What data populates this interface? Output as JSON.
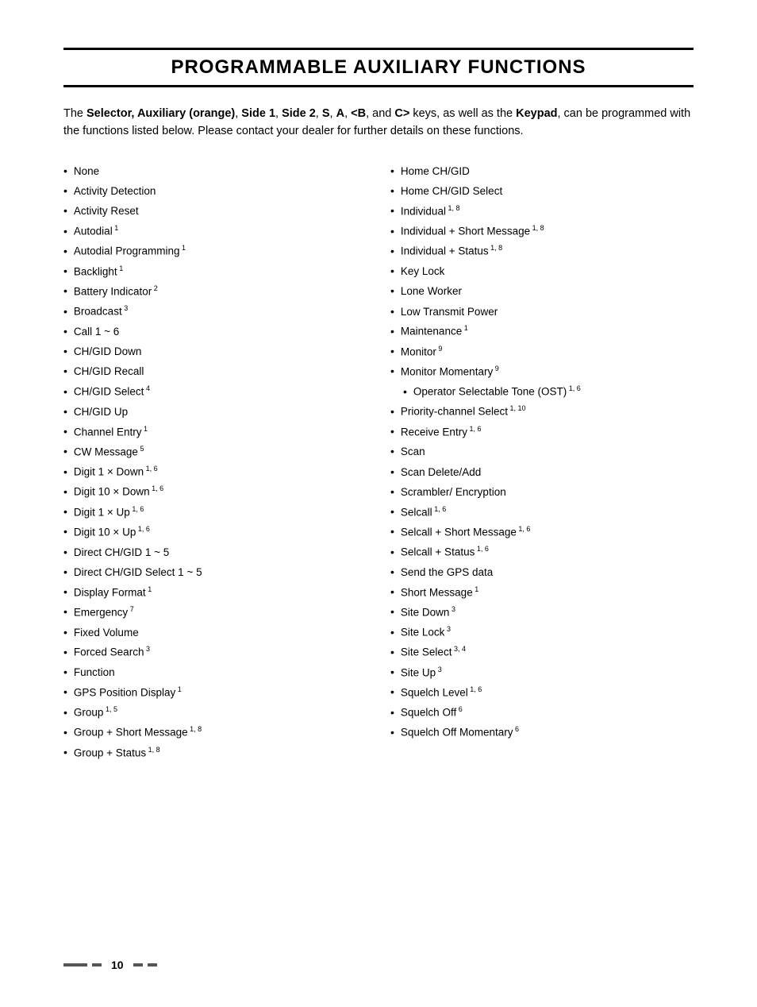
{
  "page": {
    "title": "PROGRAMMABLE AUXILIARY FUNCTIONS",
    "intro": {
      "part1": "The ",
      "bold1": "Selector, Auxiliary (orange)",
      "part2": ", ",
      "bold2": "Side 1",
      "part3": ", ",
      "bold3": "Side 2",
      "part4": ", ",
      "bold4": "S",
      "part5": ", ",
      "bold5": "A",
      "part6": ", ",
      "bold6": "<B",
      "part7": ", and ",
      "bold7": "C>",
      "part8": " keys, as well as the ",
      "bold8": "Keypad",
      "part9": ", can be programmed with the functions listed below. Please contact your dealer for further details on these functions."
    },
    "left_column": [
      {
        "text": "None",
        "sup": ""
      },
      {
        "text": "Activity Detection",
        "sup": ""
      },
      {
        "text": "Activity Reset",
        "sup": ""
      },
      {
        "text": "Autodial",
        "sup": "1"
      },
      {
        "text": "Autodial Programming",
        "sup": "1"
      },
      {
        "text": "Backlight",
        "sup": "1"
      },
      {
        "text": "Battery Indicator",
        "sup": "2"
      },
      {
        "text": "Broadcast",
        "sup": "3"
      },
      {
        "text": "Call 1 ~ 6",
        "sup": ""
      },
      {
        "text": "CH/GID Down",
        "sup": ""
      },
      {
        "text": "CH/GID Recall",
        "sup": ""
      },
      {
        "text": "CH/GID Select",
        "sup": "4"
      },
      {
        "text": "CH/GID Up",
        "sup": ""
      },
      {
        "text": "Channel Entry",
        "sup": "1"
      },
      {
        "text": "CW Message",
        "sup": "5"
      },
      {
        "text": "Digit 1 × Down",
        "sup": "1, 6"
      },
      {
        "text": "Digit 10 × Down",
        "sup": "1, 6"
      },
      {
        "text": "Digit 1 × Up",
        "sup": "1, 6"
      },
      {
        "text": "Digit 10 × Up",
        "sup": "1, 6"
      },
      {
        "text": "Direct CH/GID 1 ~ 5",
        "sup": ""
      },
      {
        "text": "Direct CH/GID Select 1 ~ 5",
        "sup": ""
      },
      {
        "text": "Display Format",
        "sup": "1"
      },
      {
        "text": "Emergency",
        "sup": "7"
      },
      {
        "text": "Fixed Volume",
        "sup": ""
      },
      {
        "text": "Forced Search",
        "sup": "3"
      },
      {
        "text": "Function",
        "sup": ""
      },
      {
        "text": "GPS Position Display",
        "sup": "1"
      },
      {
        "text": "Group",
        "sup": "1, 5"
      },
      {
        "text": "Group + Short Message",
        "sup": "1, 8"
      },
      {
        "text": "Group + Status",
        "sup": "1, 8"
      }
    ],
    "right_column": [
      {
        "text": "Home CH/GID",
        "sup": ""
      },
      {
        "text": "Home CH/GID Select",
        "sup": ""
      },
      {
        "text": "Individual",
        "sup": "1, 8"
      },
      {
        "text": "Individual + Short Message",
        "sup": "1, 8"
      },
      {
        "text": "Individual + Status",
        "sup": "1, 8"
      },
      {
        "text": "Key Lock",
        "sup": ""
      },
      {
        "text": "Lone Worker",
        "sup": ""
      },
      {
        "text": "Low Transmit Power",
        "sup": ""
      },
      {
        "text": "Maintenance",
        "sup": "1"
      },
      {
        "text": "Monitor",
        "sup": "9"
      },
      {
        "text": "Monitor Momentary",
        "sup": "9"
      },
      {
        "text": "Operator Selectable Tone (OST)",
        "sup": "1, 6",
        "indent": true
      },
      {
        "text": "Priority-channel Select",
        "sup": "1, 10"
      },
      {
        "text": "Receive Entry",
        "sup": "1, 6"
      },
      {
        "text": "Scan",
        "sup": ""
      },
      {
        "text": "Scan Delete/Add",
        "sup": ""
      },
      {
        "text": "Scrambler/ Encryption",
        "sup": ""
      },
      {
        "text": "Selcall",
        "sup": "1, 6"
      },
      {
        "text": "Selcall + Short Message",
        "sup": "1, 6"
      },
      {
        "text": "Selcall + Status",
        "sup": "1, 6"
      },
      {
        "text": "Send the GPS data",
        "sup": ""
      },
      {
        "text": "Short Message",
        "sup": "1"
      },
      {
        "text": "Site Down",
        "sup": "3"
      },
      {
        "text": "Site Lock",
        "sup": "3"
      },
      {
        "text": "Site Select",
        "sup": "3, 4"
      },
      {
        "text": "Site Up",
        "sup": "3"
      },
      {
        "text": "Squelch Level",
        "sup": "1, 6"
      },
      {
        "text": "Squelch Off",
        "sup": "6"
      },
      {
        "text": "Squelch Off Momentary",
        "sup": "6"
      }
    ],
    "footer": {
      "page_number": "10"
    }
  }
}
